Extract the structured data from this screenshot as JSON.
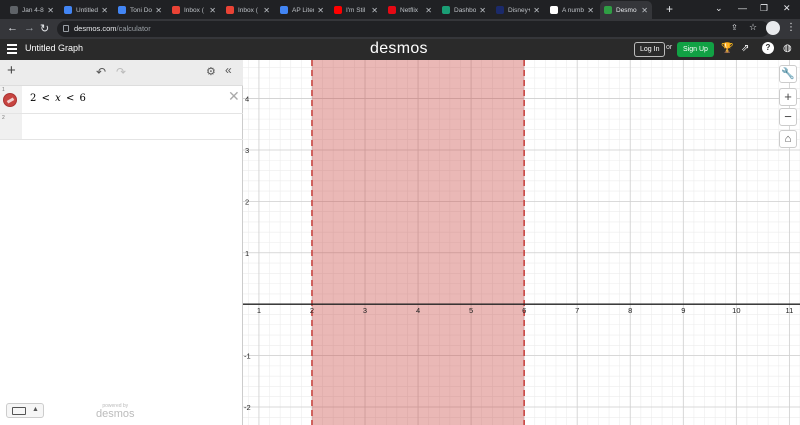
{
  "browser": {
    "tabs": [
      {
        "title": "Jan 4-8",
        "color": "#5f6368"
      },
      {
        "title": "Untitled",
        "color": "#4285f4"
      },
      {
        "title": "Toni Do",
        "color": "#4285f4"
      },
      {
        "title": "Inbox (",
        "color": "#ea4335"
      },
      {
        "title": "Inbox (",
        "color": "#ea4335"
      },
      {
        "title": "AP Liter",
        "color": "#4285f4"
      },
      {
        "title": "I'm Stil",
        "color": "#ff0000"
      },
      {
        "title": "Netflix",
        "color": "#e50914"
      },
      {
        "title": "Dashbo",
        "color": "#1a9e75"
      },
      {
        "title": "Disney+",
        "color": "#1b2a6b"
      },
      {
        "title": "A numb",
        "color": "#ffffff"
      },
      {
        "title": "Desmo",
        "color": "#2f9e44"
      }
    ],
    "active_tab_index": 11,
    "url_host": "desmos.com",
    "url_path": "/calculator"
  },
  "header": {
    "title": "Untitled Graph",
    "logo": "desmos",
    "login_label": "Log In",
    "or_label": "or",
    "signup_label": "Sign Up"
  },
  "expressions": [
    {
      "index": "1",
      "latex_parts": [
        "2",
        "<",
        "x",
        "<",
        "6"
      ],
      "color": "#c74440"
    },
    {
      "index": "2"
    }
  ],
  "footer": {
    "powered_small": "powered by",
    "powered_logo": "desmos"
  },
  "graph": {
    "x_ticks": [
      "1",
      "2",
      "3",
      "4",
      "5",
      "6",
      "7",
      "8",
      "9",
      "10",
      "11"
    ],
    "y_ticks_pos": [
      "1",
      "2",
      "3",
      "4"
    ],
    "y_ticks_neg": [
      "-1",
      "-2"
    ],
    "xmin": 0.7,
    "xmax": 11.2,
    "ymin": -2.35,
    "ymax": 4.75,
    "shade": {
      "from": 2,
      "to": 6,
      "color": "#c74440"
    }
  }
}
